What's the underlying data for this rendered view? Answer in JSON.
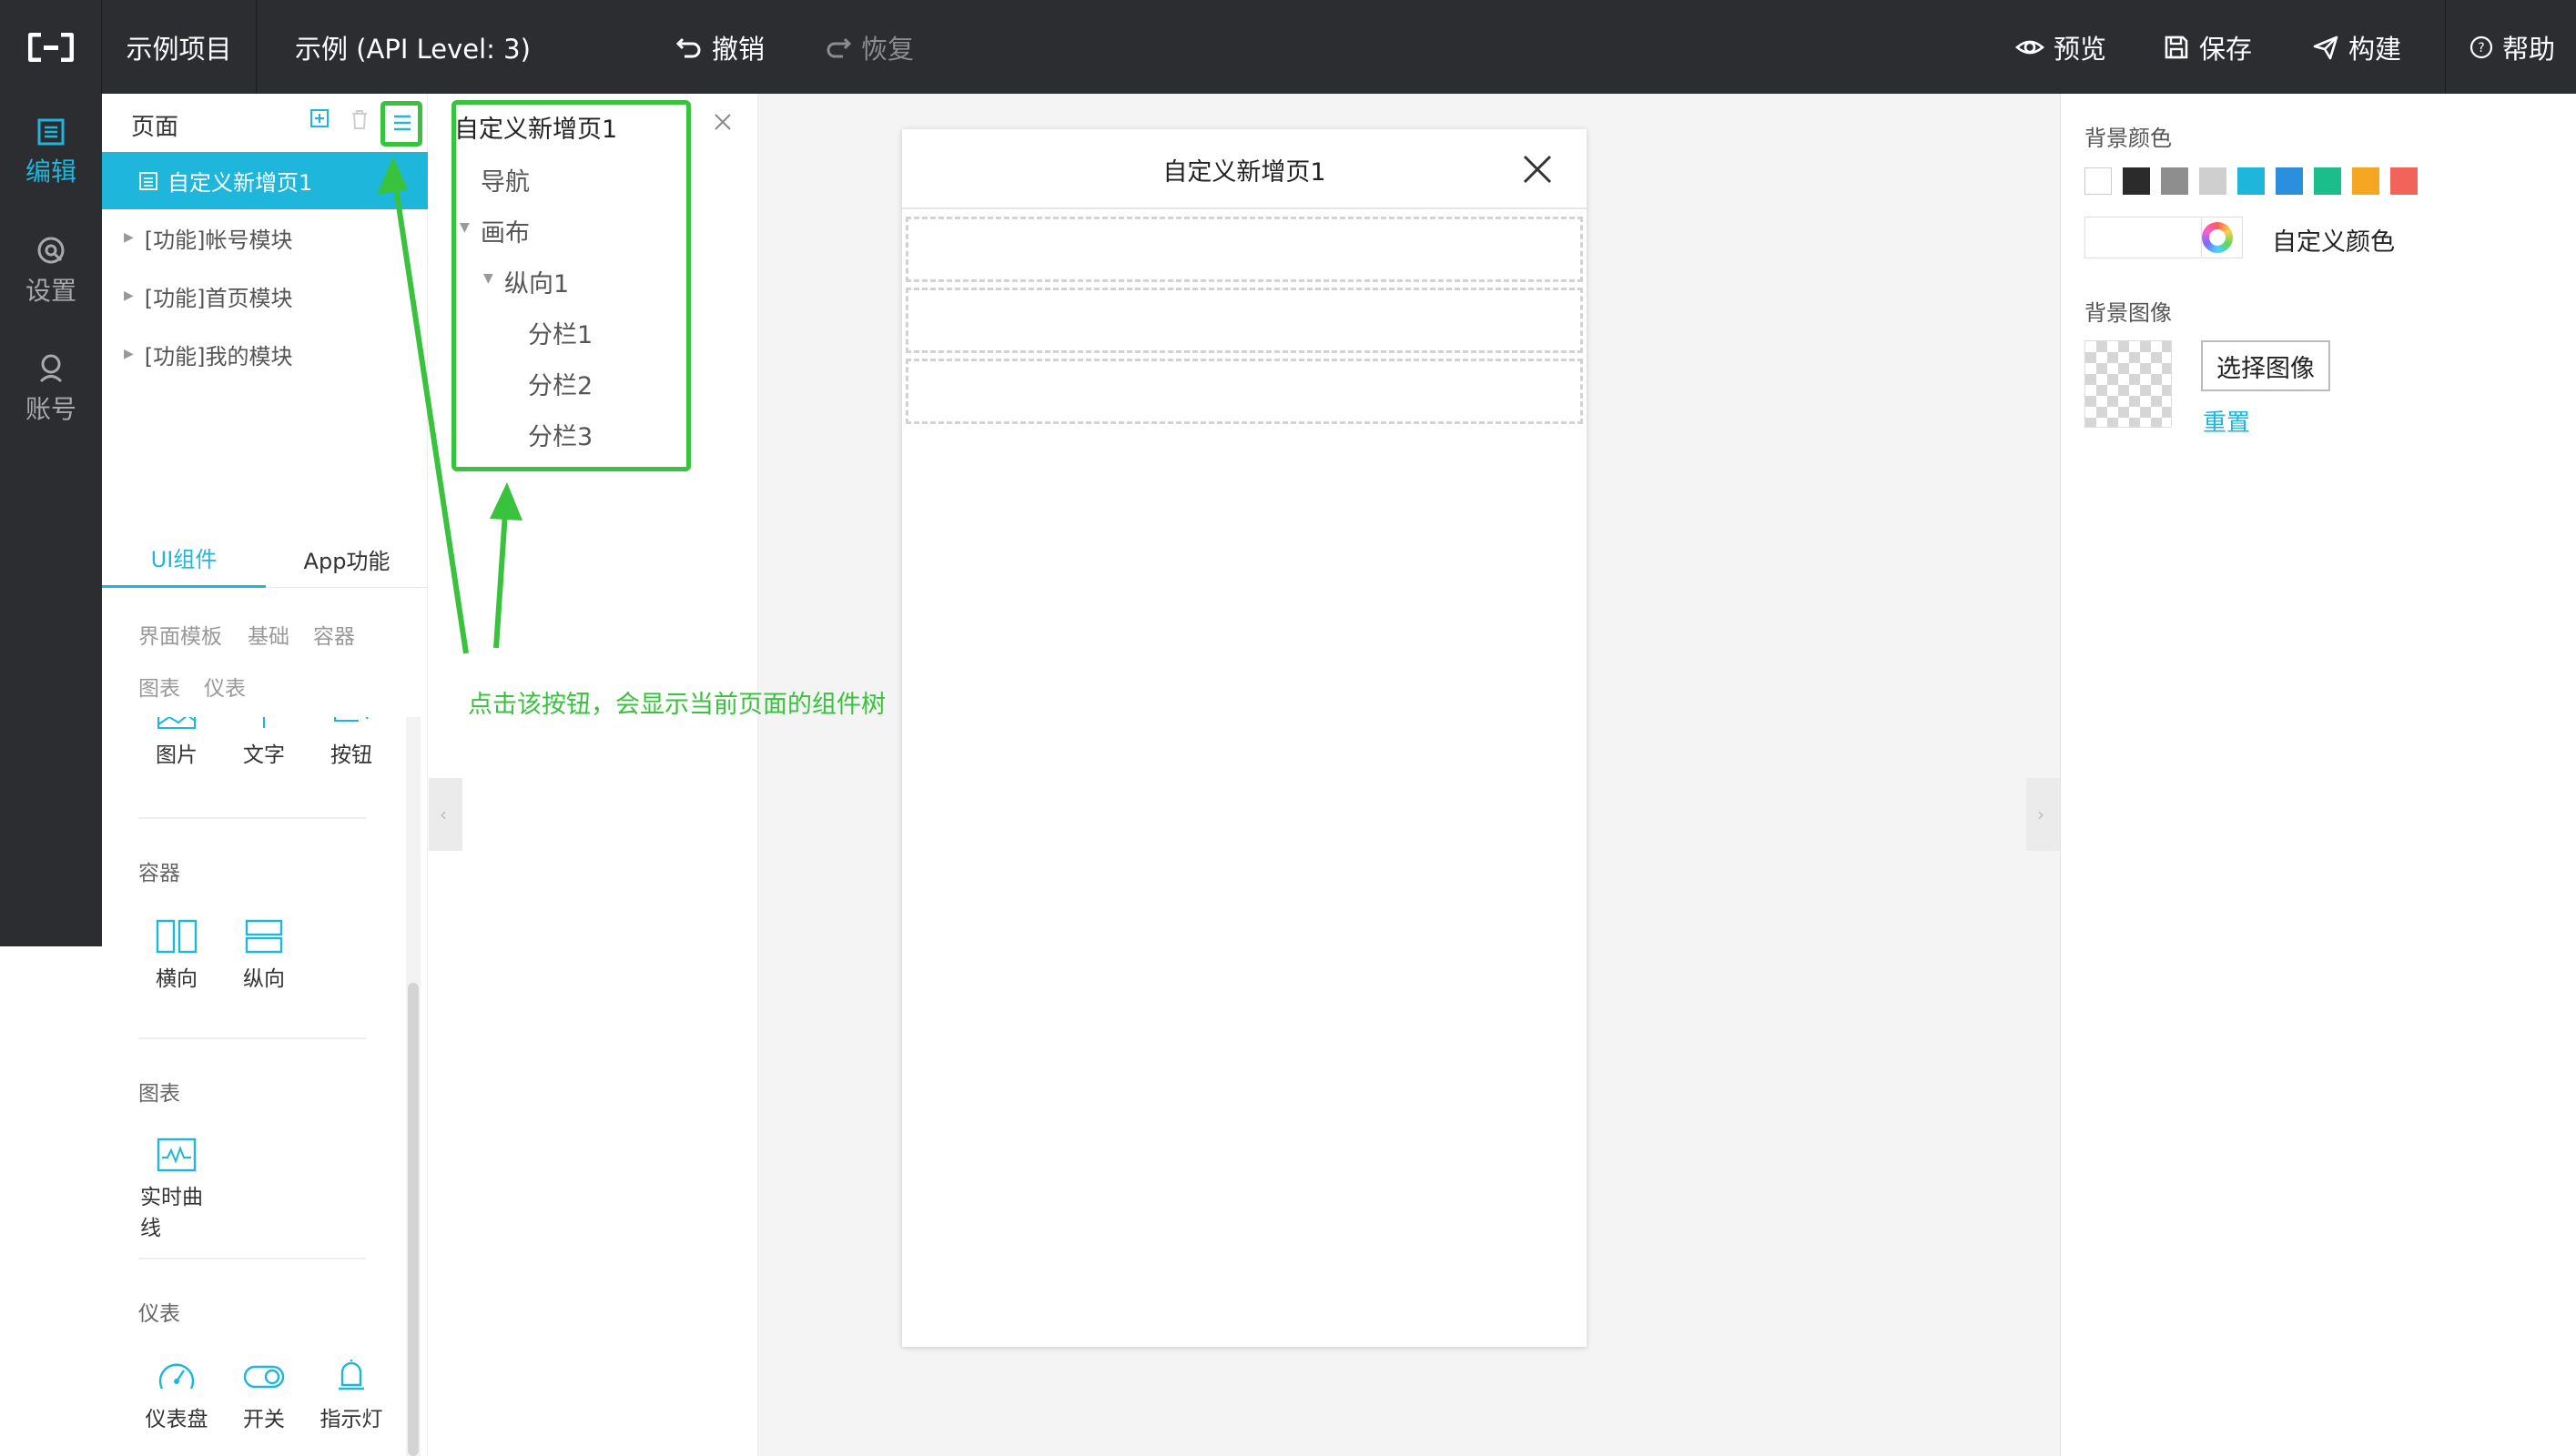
{
  "topbar": {
    "project": "示例项目",
    "api": "示例 (API Level: 3)",
    "undo": "撤销",
    "redo": "恢复",
    "preview": "预览",
    "save": "保存",
    "build": "构建",
    "help": "帮助"
  },
  "nav": {
    "edit": "编辑",
    "settings": "设置",
    "account": "账号"
  },
  "pages": {
    "title": "页面",
    "selected": "自定义新增页1",
    "items": [
      "[功能]帐号模块",
      "[功能]首页模块",
      "[功能]我的模块"
    ]
  },
  "components": {
    "tabs": [
      "UI组件",
      "App功能"
    ],
    "categories": [
      "界面模板",
      "基础",
      "容器",
      "图表",
      "仪表"
    ],
    "basic": [
      "图片",
      "文字",
      "按钮"
    ],
    "container_title": "容器",
    "container": [
      "横向",
      "纵向"
    ],
    "chart_title": "图表",
    "chart": [
      "实时曲线"
    ],
    "gauge_title": "仪表",
    "gauge": [
      "仪表盘",
      "开关",
      "指示灯"
    ]
  },
  "tree": {
    "title": "自定义新增页1",
    "nodes": [
      "导航",
      "画布",
      "纵向1",
      "分栏1",
      "分栏2",
      "分栏3"
    ]
  },
  "canvas": {
    "page_title": "自定义新增页1"
  },
  "props": {
    "bg_color_label": "背景颜色",
    "swatch_colors": [
      "#ffffff",
      "#2b2b2b",
      "#8e8e8e",
      "#cfcfcf",
      "#1fb6dc",
      "#2b8fde",
      "#1bbd8a",
      "#f5a623",
      "#f2645a"
    ],
    "custom_color": "自定义颜色",
    "bg_image_label": "背景图像",
    "choose_image": "选择图像",
    "reset": "重置"
  },
  "annotation": "点击该按钮，会显示当前页面的组件树"
}
